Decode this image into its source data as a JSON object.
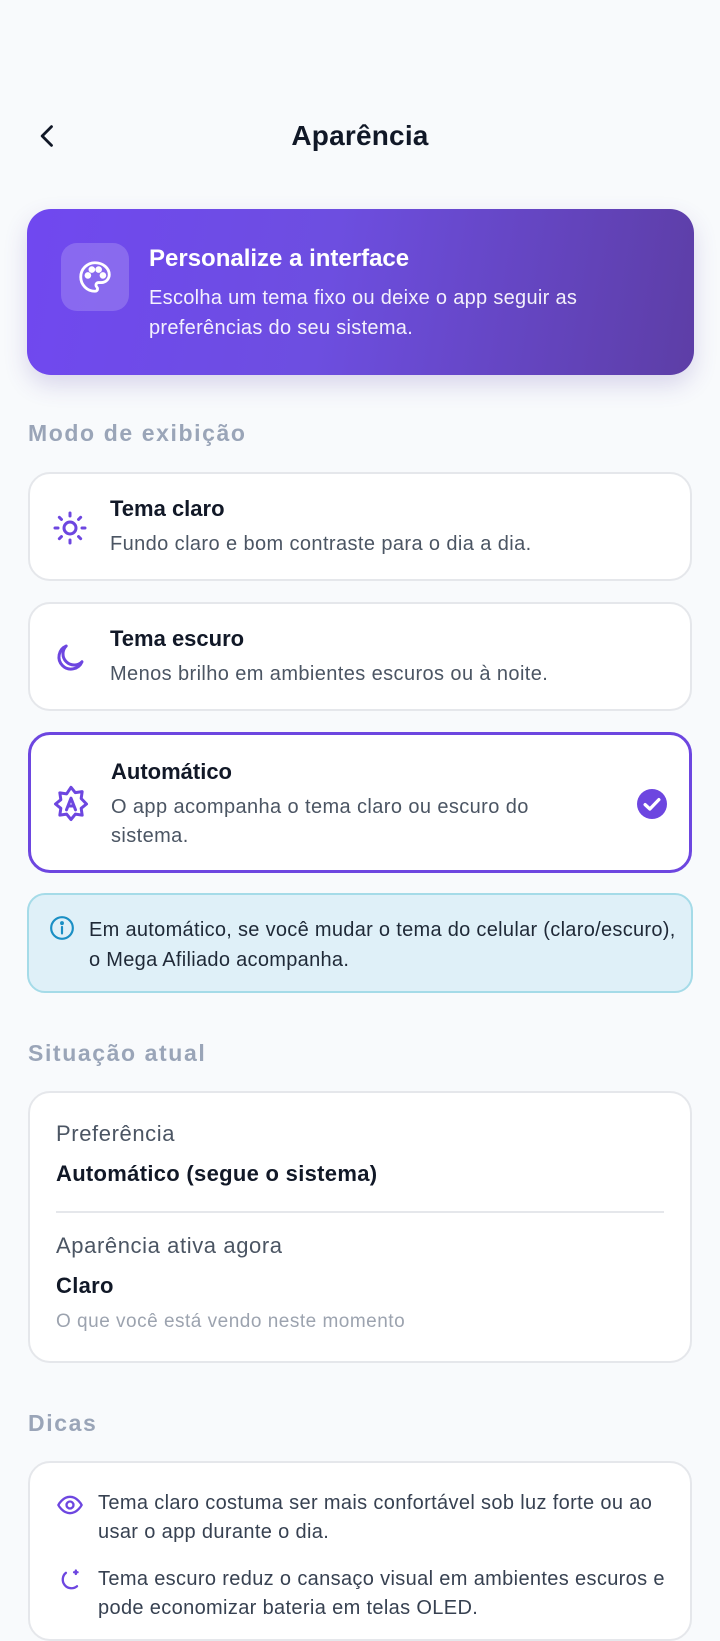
{
  "header": {
    "title": "Aparência"
  },
  "hero": {
    "title": "Personalize a interface",
    "subtitle": "Escolha um tema fixo ou deixe o app seguir as preferências do seu sistema."
  },
  "display_mode": {
    "section_title": "Modo de exibição",
    "options": [
      {
        "title": "Tema claro",
        "description": "Fundo claro e bom contraste para o dia a dia.",
        "icon": "sun-icon",
        "selected": false
      },
      {
        "title": "Tema escuro",
        "description": "Menos brilho em ambientes escuros ou à noite.",
        "icon": "moon-icon",
        "selected": false
      },
      {
        "title": "Automático",
        "description": "O app acompanha o tema claro ou escuro do sistema.",
        "icon": "auto-theme-icon",
        "selected": true
      }
    ]
  },
  "info": {
    "text": "Em automático, se você mudar o tema do celular (claro/escuro), o Mega Afiliado acompanha."
  },
  "current_status": {
    "section_title": "Situação atual",
    "preference_label": "Preferência",
    "preference_value": "Automático (segue o sistema)",
    "active_label": "Aparência ativa agora",
    "active_value": "Claro",
    "active_note": "O que você está vendo neste momento"
  },
  "tips": {
    "section_title": "Dicas",
    "items": [
      {
        "icon": "eye-icon",
        "text": "Tema claro costuma ser mais confortável sob luz forte ou ao usar o app durante o dia."
      },
      {
        "icon": "moon-stars-icon",
        "text": "Tema escuro reduz o cansaço visual em ambientes escuros e pode economizar bateria em telas OLED."
      }
    ]
  },
  "colors": {
    "accent": "#6d46e0",
    "background": "#f8fafc",
    "info_bg": "#dff0f8",
    "info_border": "#a5dbe8",
    "section_title": "#9aa5b8"
  }
}
